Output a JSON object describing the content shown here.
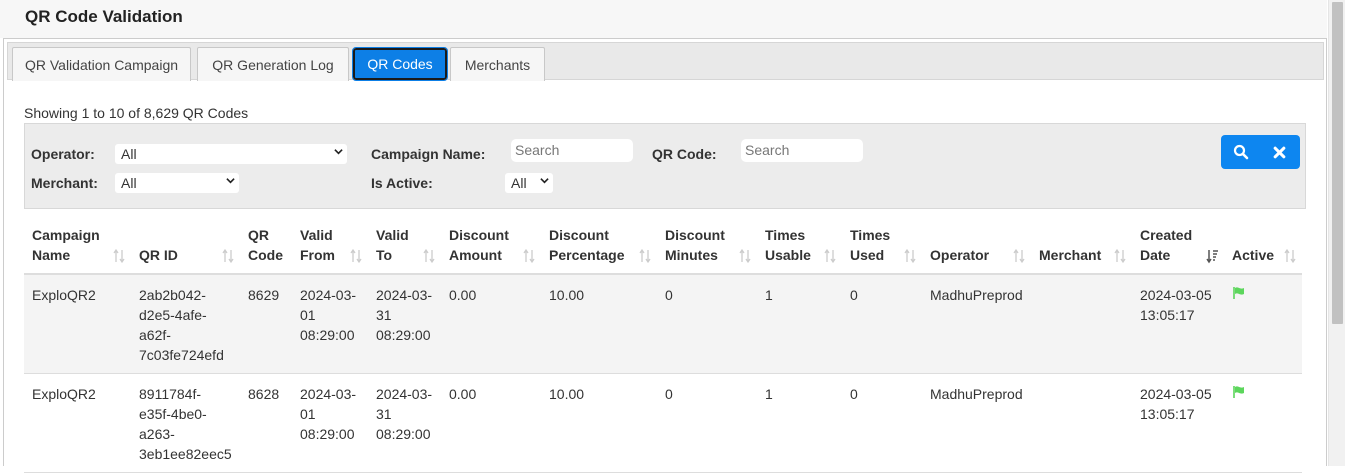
{
  "page": {
    "title": "QR Code Validation"
  },
  "tabs": [
    {
      "label": "QR Validation Campaign",
      "active": false
    },
    {
      "label": "QR Generation Log",
      "active": false
    },
    {
      "label": "QR Codes",
      "active": true
    },
    {
      "label": "Merchants",
      "active": false
    }
  ],
  "summary": "Showing 1 to 10 of 8,629 QR Codes",
  "filters": {
    "operator_label": "Operator:",
    "operator_value": "All",
    "merchant_label": "Merchant:",
    "merchant_value": "All",
    "campaign_label": "Campaign Name:",
    "campaign_placeholder": "Search",
    "isactive_label": "Is Active:",
    "isactive_value": "All",
    "qrcode_label": "QR Code:",
    "qrcode_placeholder": "Search"
  },
  "buttons": {
    "search_icon": "search-icon",
    "clear_icon": "close-icon"
  },
  "table": {
    "headers": [
      "Campaign Name",
      "QR ID",
      "QR Code",
      "Valid From",
      "Valid To",
      "Discount Amount",
      "Discount Percentage",
      "Discount Minutes",
      "Times Usable",
      "Times Used",
      "Operator",
      "Merchant",
      "Created Date",
      "Active"
    ],
    "rows": [
      {
        "campaign": "ExploQR2",
        "qr_id": [
          "2ab2b042-",
          "d2e5-4afe-",
          "a62f-",
          "7c03fe724efd"
        ],
        "qr_code": "8629",
        "valid_from": [
          "2024-03-",
          "01",
          "08:29:00"
        ],
        "valid_to": [
          "2024-03-",
          "31",
          "08:29:00"
        ],
        "discount_amount": "0.00",
        "discount_percentage": "10.00",
        "discount_minutes": "0",
        "times_usable": "1",
        "times_used": "0",
        "operator": "MadhuPreprod",
        "merchant": "",
        "created": [
          "2024-03-05",
          "13:05:17"
        ],
        "active_icon": "flag-icon"
      },
      {
        "campaign": "ExploQR2",
        "qr_id": [
          "8911784f-",
          "e35f-4be0-",
          "a263-",
          "3eb1ee82eec5"
        ],
        "qr_code": "8628",
        "valid_from": [
          "2024-03-",
          "01",
          "08:29:00"
        ],
        "valid_to": [
          "2024-03-",
          "31",
          "08:29:00"
        ],
        "discount_amount": "0.00",
        "discount_percentage": "10.00",
        "discount_minutes": "0",
        "times_usable": "1",
        "times_used": "0",
        "operator": "MadhuPreprod",
        "merchant": "",
        "created": [
          "2024-03-05",
          "13:05:17"
        ],
        "active_icon": "flag-icon"
      }
    ]
  },
  "colors": {
    "accent": "#0d7fe6",
    "flag": "#5cd65c"
  }
}
